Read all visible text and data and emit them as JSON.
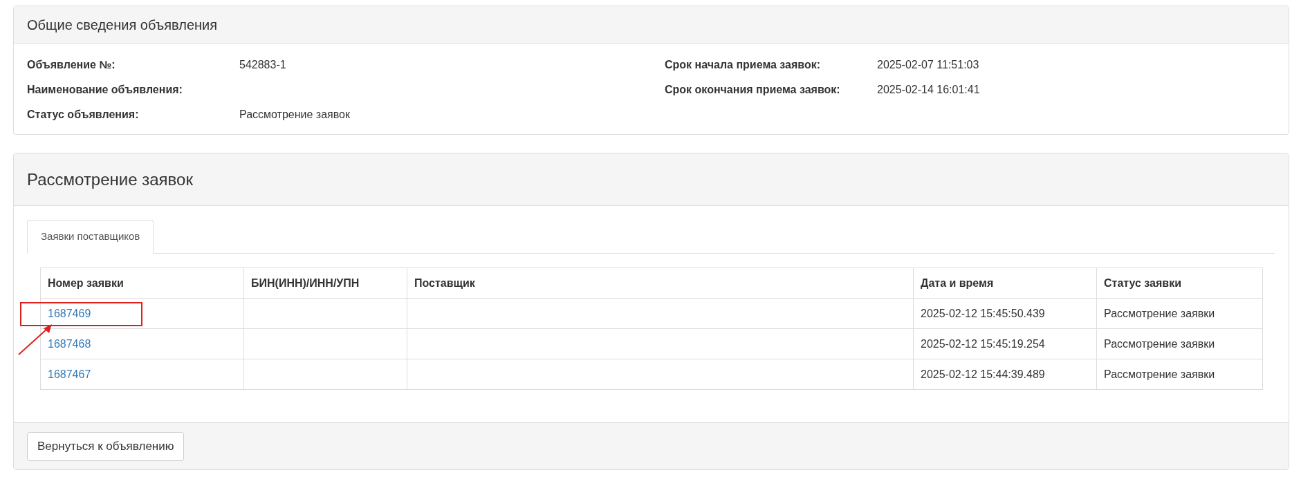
{
  "info_panel": {
    "title": "Общие сведения объявления",
    "left_fields": [
      {
        "label": "Объявление №:",
        "value": "542883-1"
      },
      {
        "label": "Наименование объявления:"
      },
      {
        "label": "Статус объявления:",
        "value": "Рассмотрение заявок"
      }
    ],
    "right_fields": [
      {
        "label": "Срок начала приема заявок:",
        "value": "2025-02-07 11:51:03"
      },
      {
        "label": "Срок окончания приема заявок:",
        "value": "2025-02-14 16:01:41"
      }
    ]
  },
  "review_panel": {
    "title": "Рассмотрение заявок",
    "tabs": [
      {
        "label": "Заявки поставщиков",
        "selected": true
      }
    ],
    "table": {
      "columns": [
        "Номер заявки",
        "БИН(ИНН)/ИНН/УПН",
        "Поставщик",
        "Дата и время",
        "Статус заявки"
      ],
      "rows": [
        {
          "number": "1687469",
          "datetime": "2025-02-12 15:45:50.439",
          "status": "Рассмотрение заявки",
          "highlighted": true
        },
        {
          "number": "1687468",
          "datetime": "2025-02-12 15:45:19.254",
          "status": "Рассмотрение заявки",
          "highlighted": false
        },
        {
          "number": "1687467",
          "datetime": "2025-02-12 15:44:39.489",
          "status": "Рассмотрение заявки",
          "highlighted": false
        }
      ]
    },
    "back_button": "Вернуться к объявлению"
  }
}
